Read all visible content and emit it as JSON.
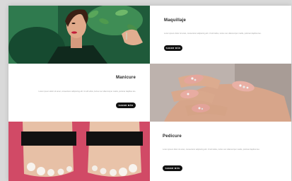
{
  "services": [
    {
      "title": "Maquillaje",
      "description": "Lorem ipsum dolor sit amet, consectetur adipiscing elit. Ut elit tellus, luctus nec ullamcorper mattis, pulvinar dapibus leo.",
      "button": "SABER MÁS",
      "image": "makeup-model-photo"
    },
    {
      "title": "Manicure",
      "description": "Lorem ipsum dolor sit amet, consectetur adipiscing elit. Ut elit tellus, luctus nec ullamcorper mattis, pulvinar dapibus leo.",
      "button": "SABER MÁS",
      "image": "manicure-nails-photo"
    },
    {
      "title": "Pedicure",
      "description": "Lorem ipsum dolor sit amet, consectetur adipiscing elit. Ut elit tellus, luctus nec ullamcorper mattis, pulvinar dapibus leo.",
      "button": "SABER MÁS",
      "image": "pedicure-feet-photo"
    }
  ],
  "colors": {
    "button_bg": "#111111",
    "button_text": "#ffffff",
    "title": "#222222",
    "description": "#9a9a9a",
    "page_bg": "#ffffff",
    "backdrop": "#d9d9d9"
  }
}
